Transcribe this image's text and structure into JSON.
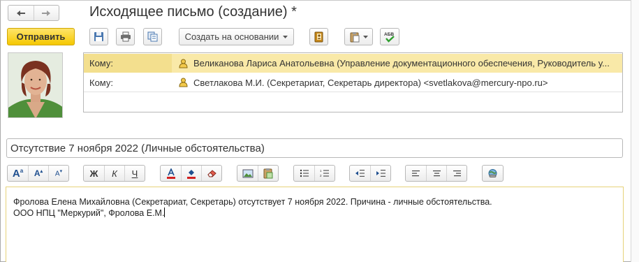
{
  "window": {
    "title": "Исходящее письмо (создание) *"
  },
  "nav": {
    "back_icon": "arrow-left-icon",
    "forward_icon": "arrow-right-icon"
  },
  "toolbar": {
    "send_label": "Отправить",
    "save_icon": "floppy-disk-icon",
    "print_icon": "printer-icon",
    "copy_icon": "copy-document-icon",
    "create_based_on_label": "Создать на основании",
    "address_book_icon": "address-book-icon",
    "clipboard_icon": "clipboard-icon",
    "spellcheck_icon": "spellcheck-icon",
    "spellcheck_text": "АБВ"
  },
  "recipients": [
    {
      "label": "Кому:",
      "value": "Великанова Лариса Анатольевна (Управление документационного обеспечения, Руководитель у..."
    },
    {
      "label": "Кому:",
      "value": "Светлакова М.И. (Секретариат, Секретарь директора) <svetlakova@mercury-npo.ru>"
    }
  ],
  "subject": {
    "value": "Отсутствие 7 ноября 2022 (Личные обстоятельства)"
  },
  "format_toolbar": {
    "bold_label": "Ж",
    "italic_label": "К",
    "underline_label": "Ч",
    "font_size_label": "A",
    "grow_label": "A",
    "shrink_label": "A"
  },
  "body": {
    "line1": "Фролова Елена Михайловна (Секретариат, Секретарь) отсутствует 7 ноября 2022. Причина - личные обстоятельства.",
    "line2": "ООО НПЦ \"Меркурий\", Фролова Е.М."
  },
  "colors": {
    "send_button": "#f5c800",
    "selected_row": "#f9e9a8",
    "editor_border": "#e6d27a"
  }
}
